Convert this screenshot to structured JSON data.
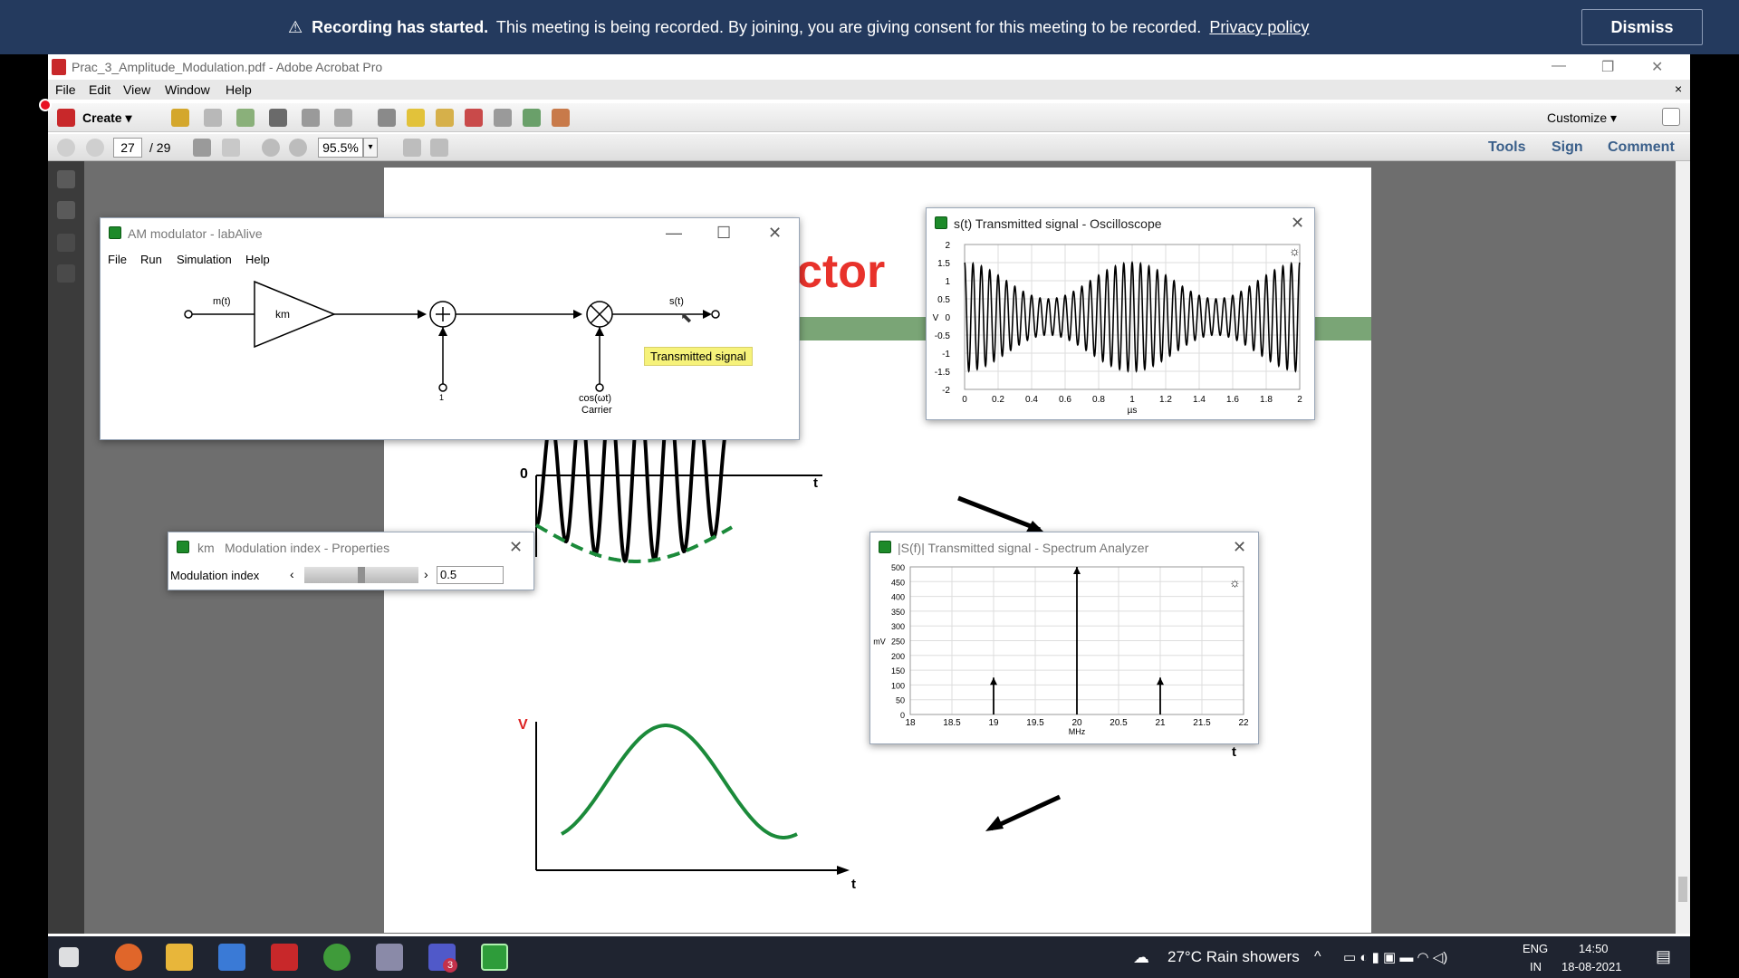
{
  "banner": {
    "bold": "Recording has started.",
    "text": "This meeting is being recorded. By joining, you are giving consent for this meeting to be recorded.",
    "link": "Privacy policy",
    "dismiss": "Dismiss"
  },
  "acrobat": {
    "title": "Prac_3_Amplitude_Modulation.pdf - Adobe Acrobat Pro",
    "menu": [
      "File",
      "Edit",
      "View",
      "Window",
      "Help"
    ],
    "create_label": "Create",
    "customize_label": "Customize",
    "page_current": "27",
    "page_total": "/ 29",
    "zoom": "95.5%",
    "right_tabs": [
      "Tools",
      "Sign",
      "Comment"
    ],
    "doc_title_fragment": "ctor",
    "zero_label": "0",
    "t_label": "t",
    "v_label": "V"
  },
  "am_window": {
    "title": "AM modulator - labAlive",
    "menu": [
      "File",
      "Run",
      "Simulation",
      "Help"
    ],
    "labels": {
      "input": "m(t)",
      "gain": "km",
      "output": "s(t)",
      "dc": "1",
      "carrier": "cos(ωt)",
      "carrier_sub": "Carrier"
    },
    "tooltip": "Transmitted signal"
  },
  "props_window": {
    "title_prefix": "km",
    "title": "Modulation index - Properties",
    "field_label": "Modulation index",
    "value": "0.5",
    "slider_fraction": 0.5
  },
  "osc_window": {
    "title": "s(t) Transmitted signal - Oscilloscope",
    "chart_data": {
      "type": "line",
      "title": "",
      "ylabel": "V",
      "xlabel": "µs",
      "xlim": [
        0,
        2
      ],
      "ylim": [
        -2,
        2
      ],
      "x_ticks": [
        "0",
        "0.2",
        "0.4",
        "0.6",
        "0.8",
        "1",
        "1.2",
        "1.4",
        "1.6",
        "1.8",
        "2"
      ],
      "y_ticks": [
        "2",
        "1.5",
        "1",
        "0.5",
        "0",
        "-0.5",
        "-1",
        "-1.5",
        "-2"
      ],
      "grid": true,
      "carrier_mhz": 20,
      "message_mhz": 1,
      "amplitude": 1,
      "modulation_index": 0.5
    }
  },
  "spec_window": {
    "title": "|S(f)| Transmitted signal - Spectrum Analyzer",
    "chart_data": {
      "type": "bar",
      "title": "",
      "ylabel": "mV",
      "xlabel": "MHz",
      "xlim": [
        18,
        22
      ],
      "ylim": [
        0,
        500
      ],
      "x_ticks": [
        "18",
        "18.5",
        "19",
        "19.5",
        "20",
        "20.5",
        "21",
        "21.5",
        "22"
      ],
      "y_ticks": [
        "500",
        "450",
        "400",
        "350",
        "300",
        "250",
        "200",
        "150",
        "100",
        "50",
        "0"
      ],
      "grid": true,
      "lines": [
        {
          "x": 19,
          "y": 125
        },
        {
          "x": 20,
          "y": 500
        },
        {
          "x": 21,
          "y": 125
        }
      ]
    }
  },
  "taskbar": {
    "weather": "27°C  Rain showers",
    "lang_top": "ENG",
    "lang_bottom": "IN",
    "time": "14:50",
    "date": "18-08-2021",
    "teams_badge": "3"
  }
}
